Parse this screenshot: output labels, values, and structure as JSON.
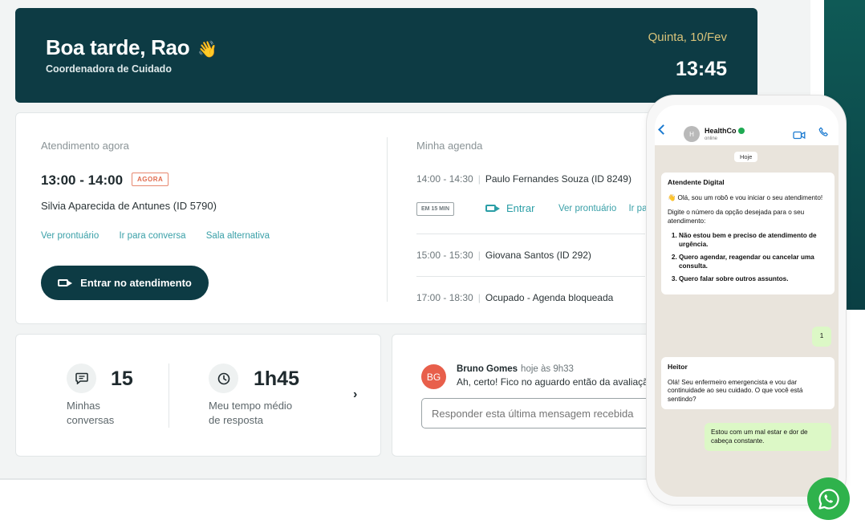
{
  "header": {
    "greeting": "Boa tarde, Rao",
    "wave": "👋",
    "role": "Coordenadora de Cuidado",
    "date": "Quinta, 10/Fev",
    "time": "13:45"
  },
  "current": {
    "title": "Atendimento agora",
    "time_range": "13:00 - 14:00",
    "badge": "AGORA",
    "patient": "Silvia Aparecida de Antunes (ID 5790)",
    "links": [
      "Ver prontuário",
      "Ir para conversa",
      "Sala alternativa"
    ],
    "enter_button": "Entrar no atendimento"
  },
  "agenda": {
    "title": "Minha agenda",
    "items": [
      {
        "time": "14:00 - 14:30",
        "who": "Paulo Fernandes Souza (ID 8249)"
      },
      {
        "time": "15:00 - 15:30",
        "who": "Giovana Santos (ID 292)"
      },
      {
        "time": "17:00 - 18:30",
        "who": "Ocupado - Agenda bloqueada"
      }
    ],
    "soon_badge": "EM 15 MIN",
    "enter": "Entrar",
    "links": [
      "Ver prontuário",
      "Ir pa"
    ]
  },
  "stats": {
    "conversations": {
      "value": "15",
      "label_1": "Minhas",
      "label_2": "conversas",
      "icon": "chat-icon"
    },
    "response": {
      "value": "1h45",
      "label_1": "Meu tempo médio",
      "label_2": "de resposta",
      "icon": "clock-icon"
    },
    "chevron": "›"
  },
  "last_message": {
    "initials": "BG",
    "author": "Bruno Gomes",
    "when": "hoje às 9h33",
    "text": "Ah, certo! Fico no aguardo então da avaliação",
    "reply_placeholder": "Responder esta última mensagem recebida"
  },
  "whatsapp": {
    "contact_initial": "H",
    "contact_name": "HealthCo",
    "contact_status": "online",
    "day_label": "Hoje",
    "bot_name": "Atendente Digital",
    "bot_intro": "👋 Olá, sou um robô e vou iniciar o seu atendimento!",
    "bot_prompt": "Digite o número da opção desejada para o seu atendimento:",
    "bot_options": [
      "Não estou bem e preciso de atendimento de urgência.",
      "Quero agendar, reagendar ou cancelar uma consulta.",
      "Quero falar sobre outros assuntos."
    ],
    "user_reply": "1",
    "nurse_name": "Heitor",
    "nurse_text": "Olá! Seu enfermeiro emergencista e vou dar continuidade ao seu cuidado. O que você está sentindo?",
    "user_message": "Estou com um mal estar e dor de cabeça constante."
  },
  "colors": {
    "header_bg": "#0d3b44",
    "accent": "#3aa0a8",
    "now_badge": "#e06a4d",
    "whatsapp_green": "#2fb24c"
  }
}
